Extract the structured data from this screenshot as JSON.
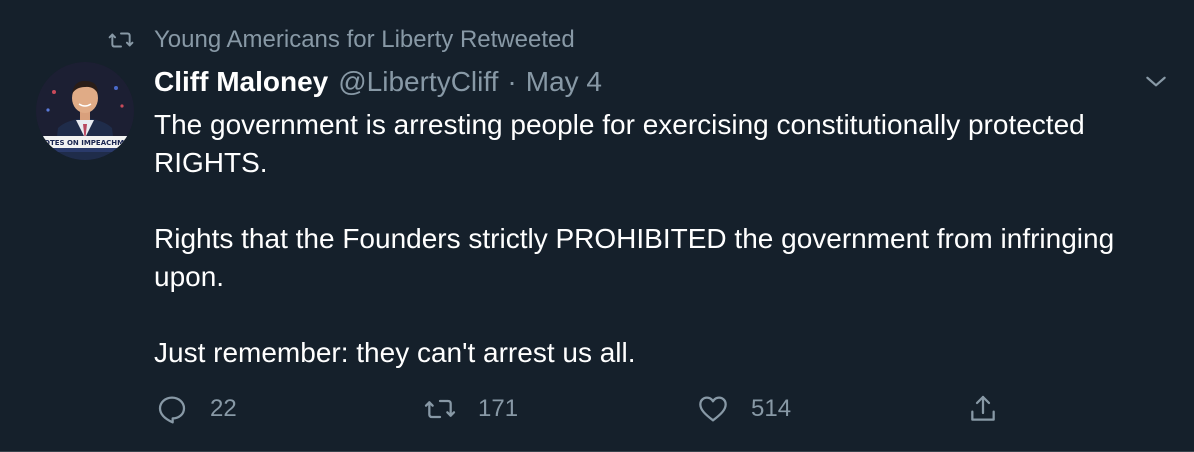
{
  "retweet_context": {
    "text": "Young Americans for Liberty Retweeted",
    "icon": "retweet-icon"
  },
  "author": {
    "display_name": "Cliff Maloney",
    "handle": "@LibertyCliff",
    "separator": "·",
    "date": "May 4",
    "avatar_caption": "OTES ON IMPEACHMENT A"
  },
  "tweet": {
    "paragraphs": [
      "The government is arresting people for exercising constitutionally protected RIGHTS.",
      "Rights that the Founders strictly PROHIBITED the government from infringing upon.",
      "Just remember: they can't arrest us all."
    ]
  },
  "actions": {
    "reply": {
      "icon": "reply-icon",
      "count": "22"
    },
    "retweet": {
      "icon": "retweet-icon",
      "count": "171"
    },
    "like": {
      "icon": "heart-icon",
      "count": "514"
    },
    "share": {
      "icon": "share-icon"
    }
  },
  "colors": {
    "background": "#15202b",
    "secondary_text": "#8899a6",
    "primary_text": "#ffffff"
  }
}
